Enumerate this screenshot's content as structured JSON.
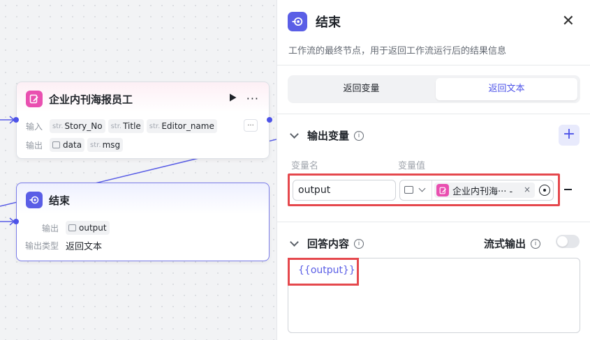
{
  "canvas": {
    "plugin_node": {
      "title": "企业内刊海报员工",
      "input_label": "输入",
      "output_label": "输出",
      "inputs": [
        {
          "type": "str.",
          "name": "Story_No"
        },
        {
          "type": "str.",
          "name": "Title"
        },
        {
          "type": "str.",
          "name": "Editor_name"
        }
      ],
      "outputs": [
        {
          "type": "image",
          "name": "data"
        },
        {
          "type": "str.",
          "name": "msg"
        }
      ],
      "more_label": "···"
    },
    "end_node": {
      "title": "结束",
      "output_label": "输出",
      "output_name": "output",
      "output_type_label": "输出类型",
      "output_type_value": "返回文本"
    }
  },
  "panel": {
    "title": "结束",
    "description": "工作流的最终节点，用于返回工作流运行后的结果信息",
    "tabs": [
      {
        "label": "返回变量",
        "active": false
      },
      {
        "label": "返回文本",
        "active": true
      }
    ],
    "output_section": {
      "title": "输出变量",
      "col_name": "变量名",
      "col_value": "变量值",
      "variable_name": "output",
      "reference_text": "企业内刊海··· -"
    },
    "answer_section": {
      "title": "回答内容",
      "stream_label": "流式输出",
      "stream_enabled": false,
      "content": "{{output}}"
    }
  },
  "colors": {
    "accent": "#4d53e8",
    "highlight": "#e5484d",
    "plugin_icon": "#e94fb0"
  }
}
